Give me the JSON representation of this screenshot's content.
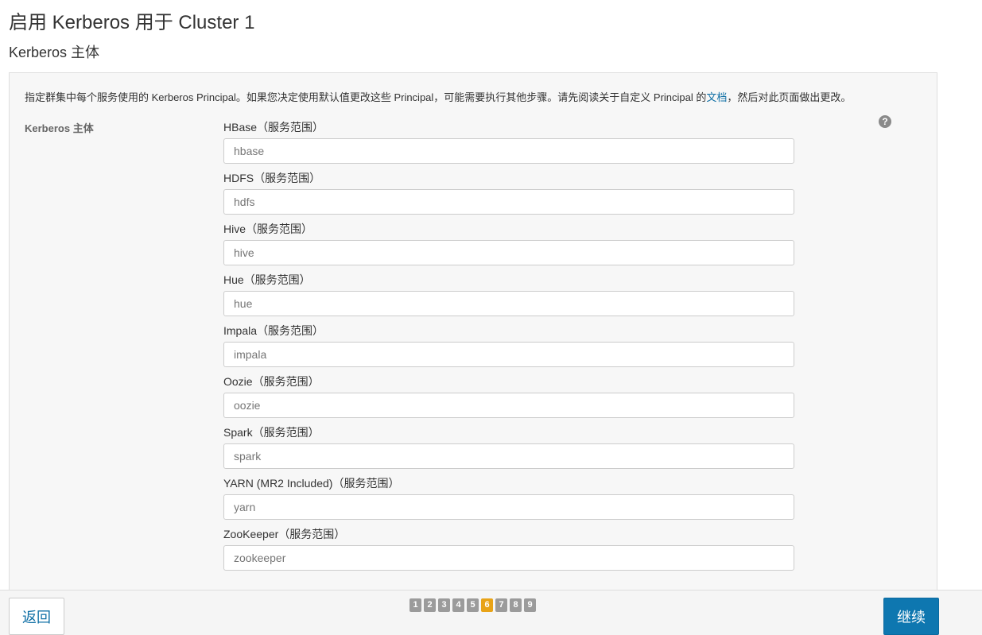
{
  "page": {
    "title": "启用 Kerberos 用于 Cluster 1",
    "section_title": "Kerberos 主体"
  },
  "panel": {
    "description_prefix": "指定群集中每个服务使用的 Kerberos Principal。如果您决定使用默认值更改这些 Principal，可能需要执行其他步骤。请先阅读关于自定义 Principal 的",
    "description_link": "文档",
    "description_suffix": "，然后对此页面做出更改。",
    "field_label": "Kerberos 主体",
    "help_icon": "?",
    "fields": [
      {
        "label": "HBase（服务范围）",
        "placeholder": "hbase"
      },
      {
        "label": "HDFS（服务范围）",
        "placeholder": "hdfs"
      },
      {
        "label": "Hive（服务范围）",
        "placeholder": "hive"
      },
      {
        "label": "Hue（服务范围）",
        "placeholder": "hue"
      },
      {
        "label": "Impala（服务范围）",
        "placeholder": "impala"
      },
      {
        "label": "Oozie（服务范围）",
        "placeholder": "oozie"
      },
      {
        "label": "Spark（服务范围）",
        "placeholder": "spark"
      },
      {
        "label": "YARN (MR2 Included)（服务范围）",
        "placeholder": "yarn"
      },
      {
        "label": "ZooKeeper（服务范围）",
        "placeholder": "zookeeper"
      }
    ]
  },
  "footer": {
    "back_label": "返回",
    "continue_label": "继续",
    "steps": [
      "1",
      "2",
      "3",
      "4",
      "5",
      "6",
      "7",
      "8",
      "9"
    ],
    "current_step": "6"
  },
  "colors": {
    "link": "#0f6fa5",
    "primary_button": "#0e77b0",
    "active_step": "#e8a317",
    "inactive_step": "#9b9b9b"
  }
}
